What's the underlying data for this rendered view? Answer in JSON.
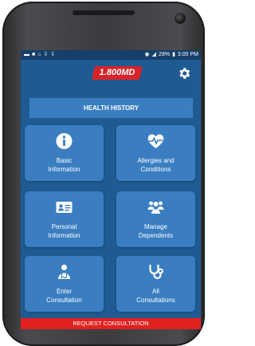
{
  "status_bar": {
    "left_icons": [
      "message-icon",
      "video-icon",
      "wifi-icon",
      "download-icon",
      "download-icon"
    ],
    "battery": "28%",
    "time": "3:00 PM"
  },
  "header": {
    "logo": "1.800MD",
    "settings_icon": "gear-icon",
    "colors": {
      "header": "#1f5a92",
      "logo_bg": "#d6252a"
    }
  },
  "health_history": {
    "label": "HEALTH HISTORY"
  },
  "tiles": [
    {
      "label": "Basic\nInformation",
      "icon": "info-icon"
    },
    {
      "label": "Allergies and\nConditions",
      "icon": "heart-pulse-icon"
    },
    {
      "label": "Personal\nInformation",
      "icon": "id-card-icon"
    },
    {
      "label": "Manage\nDependents",
      "icon": "people-icon"
    },
    {
      "label": "Enter\nConsultation",
      "icon": "doctor-icon"
    },
    {
      "label": "All\nConsultations",
      "icon": "stethoscope-icon"
    }
  ],
  "request": {
    "label": "REQUEST CONSULTATION",
    "color": "#e0211f"
  }
}
